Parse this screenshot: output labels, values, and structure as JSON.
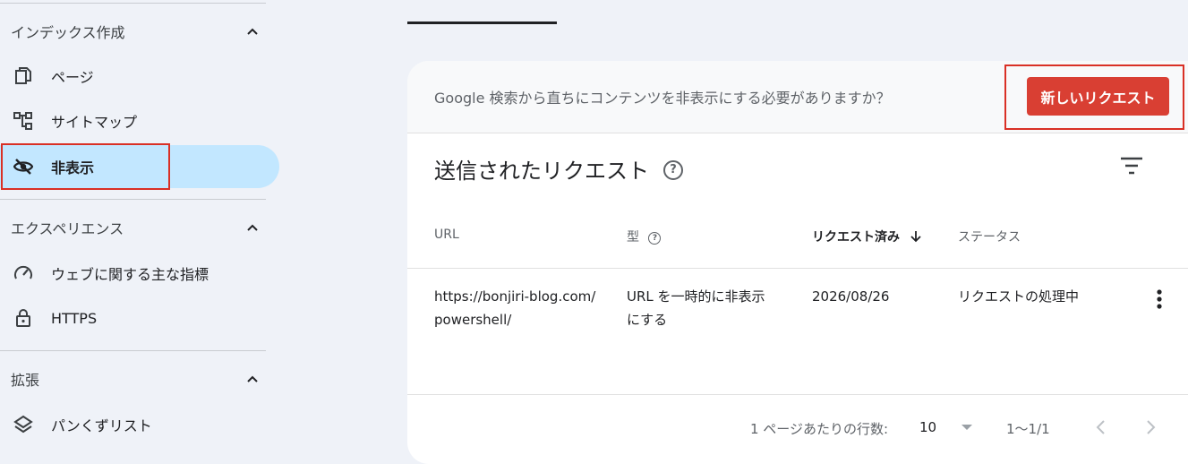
{
  "sidebar": {
    "sections": [
      {
        "title": "インデックス作成",
        "items": [
          {
            "label": "ページ",
            "icon": "page-copy-icon"
          },
          {
            "label": "サイトマップ",
            "icon": "sitemap-icon"
          },
          {
            "label": "非表示",
            "icon": "eye-off-icon",
            "active": true
          }
        ]
      },
      {
        "title": "エクスペリエンス",
        "items": [
          {
            "label": "ウェブに関する主な指標",
            "icon": "gauge-icon"
          },
          {
            "label": "HTTPS",
            "icon": "lock-icon"
          }
        ]
      },
      {
        "title": "拡張",
        "items": [
          {
            "label": "パンくずリスト",
            "icon": "layers-icon"
          }
        ]
      }
    ]
  },
  "banner": {
    "text": "Google 検索から直ちにコンテンツを非表示にする必要がありますか？",
    "button_label": "新しいリクエスト"
  },
  "main": {
    "title": "送信されたリクエスト",
    "help": "?",
    "columns": [
      "URL",
      "型",
      "リクエスト済み",
      "ステータス"
    ],
    "rows": [
      {
        "url_line1": "https://bonjiri-blog.com/",
        "url_line2": "powershell/",
        "type_line1": "URL を一時的に非表示",
        "type_line2": "にする",
        "requested": "2026/08/26",
        "status": "リクエストの処理中"
      }
    ]
  },
  "footer": {
    "rows_per_page_label": "1 ページあたりの行数:",
    "rows_per_page_value": "10",
    "range": "1〜1/1"
  },
  "colors": {
    "accent_red": "#d93f33",
    "active_nav_bg": "#c2e7ff",
    "highlight_box": "#d93025"
  }
}
